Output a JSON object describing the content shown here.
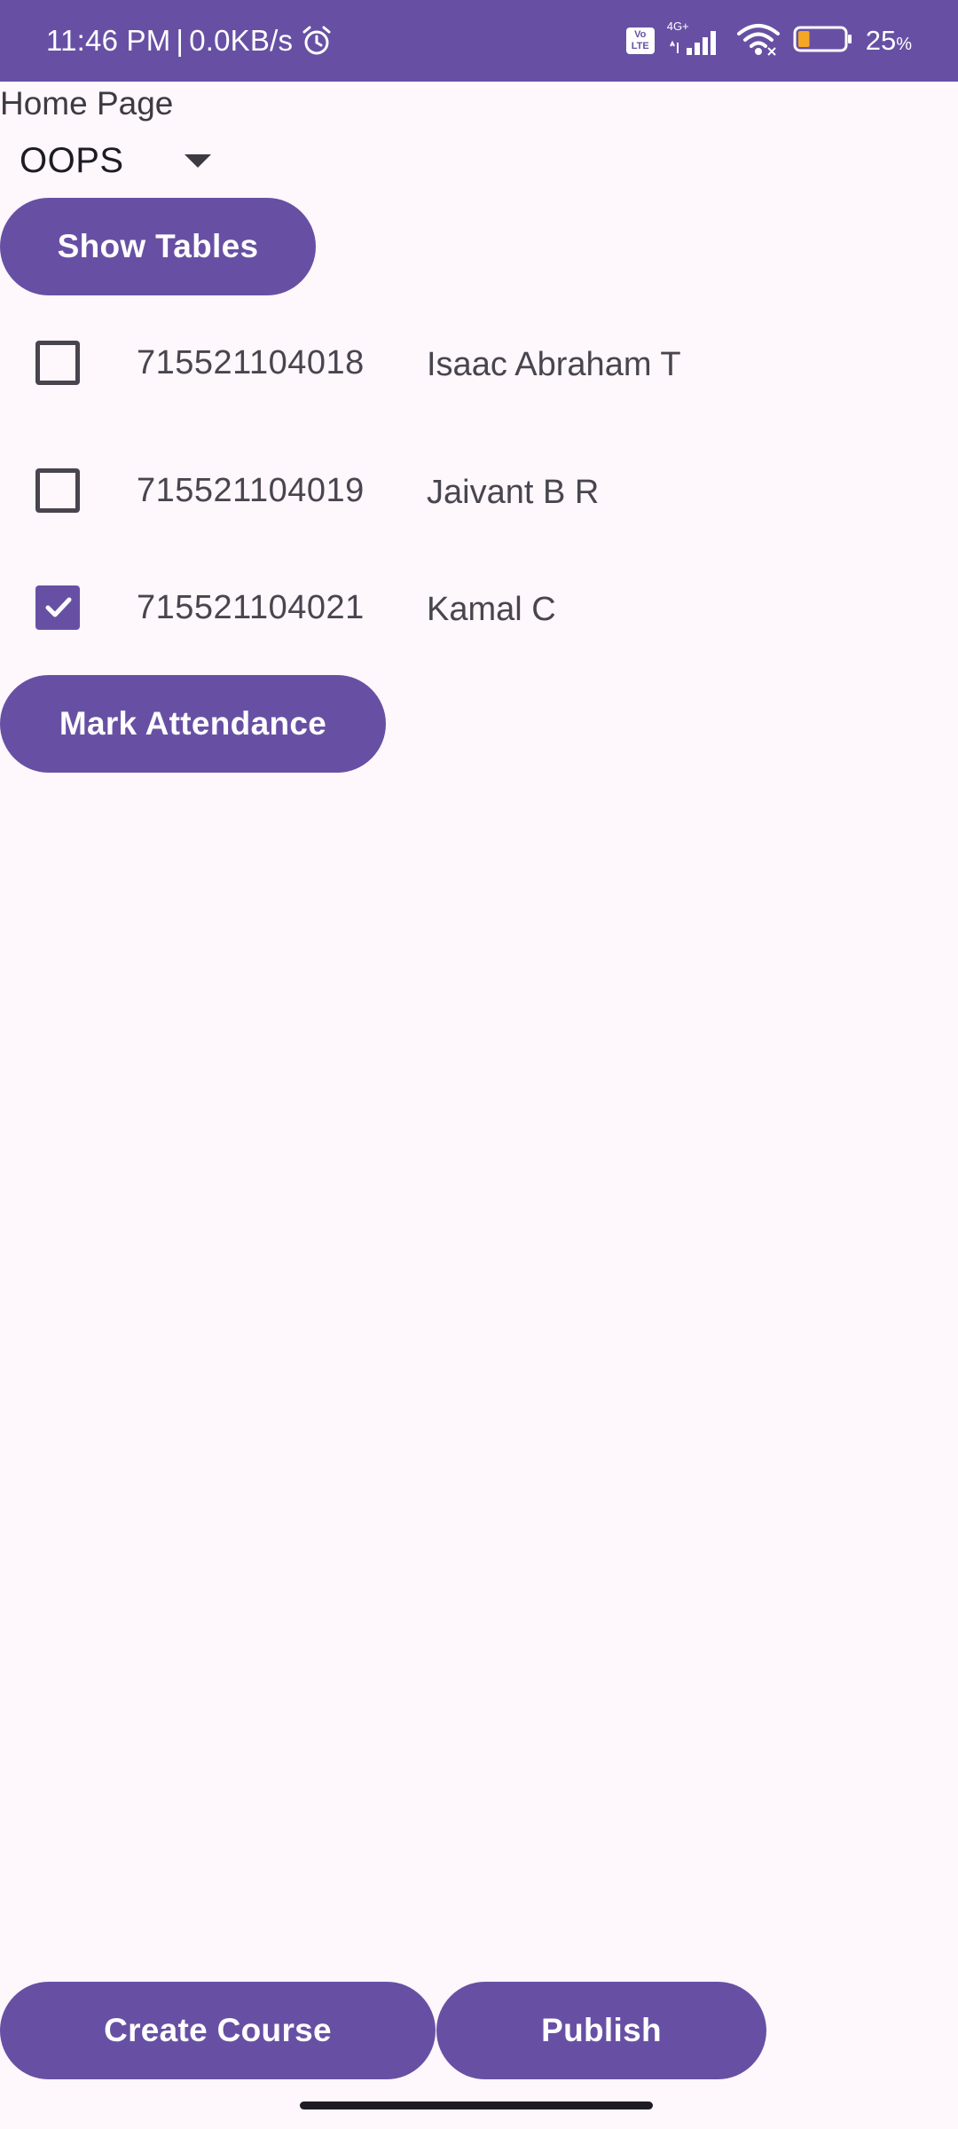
{
  "status_bar": {
    "time": "11:46 PM",
    "separator": "|",
    "net_speed": "0.0KB/s",
    "volte_top": "Vo",
    "volte_bottom": "LTE",
    "network_type": "4G+",
    "battery_percent": "25",
    "battery_unit": "%",
    "battery_level": 0.25,
    "icons": [
      "alarm-icon",
      "volte-icon",
      "signal-icon",
      "wifi-icon",
      "battery-icon"
    ],
    "color": "#6750a4"
  },
  "page": {
    "label": "Home Page",
    "course_select": {
      "selected": "OOPS"
    },
    "show_tables_label": "Show Tables",
    "mark_attendance_label": "Mark Attendance",
    "create_course_label": "Create Course",
    "publish_label": "Publish"
  },
  "students": [
    {
      "roll": "715521104018",
      "name": "Isaac Abraham T",
      "checked": false
    },
    {
      "roll": "715521104019",
      "name": "Jaivant B R",
      "checked": false
    },
    {
      "roll": "715521104021",
      "name": "Kamal C",
      "checked": true
    }
  ],
  "colors": {
    "primary": "#6750a4",
    "background": "#fef7fc",
    "text": "#49454f"
  }
}
